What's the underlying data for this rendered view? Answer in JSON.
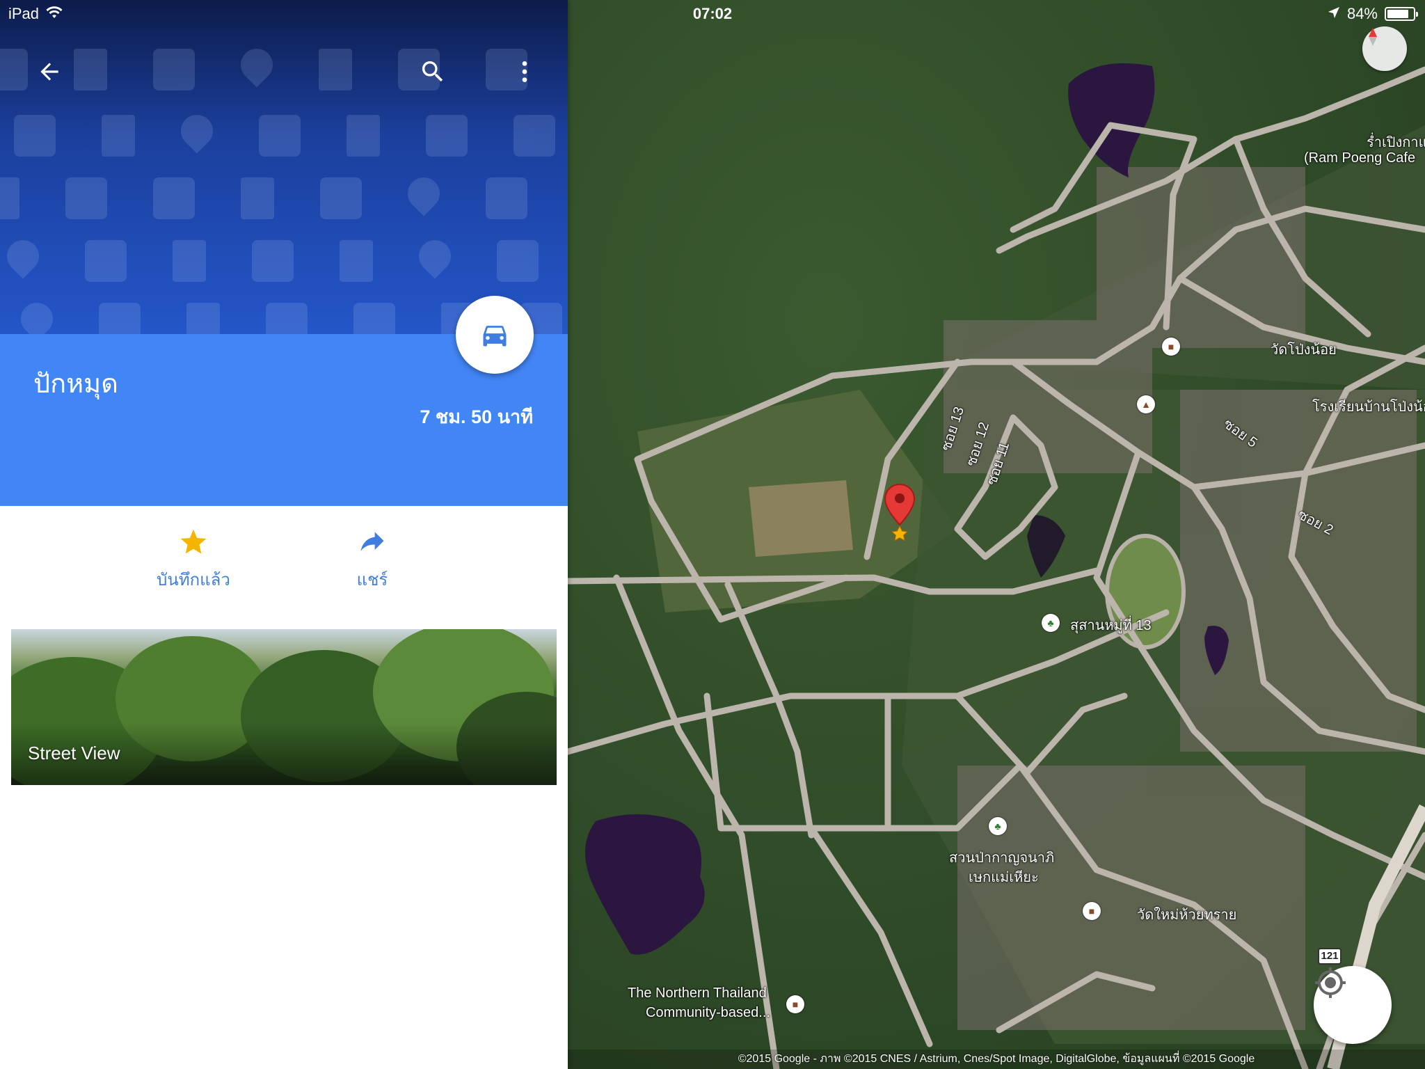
{
  "status_bar": {
    "device": "iPad",
    "time": "07:02",
    "battery": "84%",
    "battery_level": 0.84
  },
  "place": {
    "title": "ปักหมุด",
    "travel_time": "7 ชม. 50 นาที"
  },
  "actions": {
    "saved_label": "บันทึกแล้ว",
    "share_label": "แชร์"
  },
  "street_view": {
    "label": "Street View"
  },
  "map": {
    "labels": {
      "cafe_thai": "ร่ำเปิงกาแฟ",
      "cafe_en": "(Ram Poeng Cafe",
      "wat_pong_noi": "วัดโป่งน้อย",
      "school": "โรงเรียนบ้านโป่งน้อย",
      "soi13": "ซอย 13",
      "soi12": "ซอย 12",
      "soi11": "ซอย 11",
      "soi5": "ซอย 5",
      "soi2": "ซอย 2",
      "cemetery": "สุสานหมู่ที่ 13",
      "park_line1": "สวนป่ากาญจนาภิ",
      "park_line2": "เษกแม่เหียะ",
      "wat_mai": "วัดใหม่ห้วยทราย",
      "northern_line1": "The Northern Thailand",
      "northern_line2": "Community-based...",
      "route": "121"
    },
    "copyright": "©2015 Google - ภาพ ©2015 CNES / Astrium, Cnes/Spot Image, DigitalGlobe, ข้อมูลแผนที่ ©2015 Google"
  },
  "colors": {
    "header_blue": "#4285f4",
    "header_dark": "#1b3f9c",
    "action_blue": "#3f7ee0",
    "star_yellow": "#f4b400",
    "pin_red": "#e53935"
  },
  "icons": {
    "back": "arrow-back-icon",
    "search": "search-icon",
    "more": "more-vert-icon",
    "car": "car-icon",
    "star": "star-icon",
    "share": "share-icon",
    "compass": "compass-icon",
    "location": "my-location-icon"
  }
}
